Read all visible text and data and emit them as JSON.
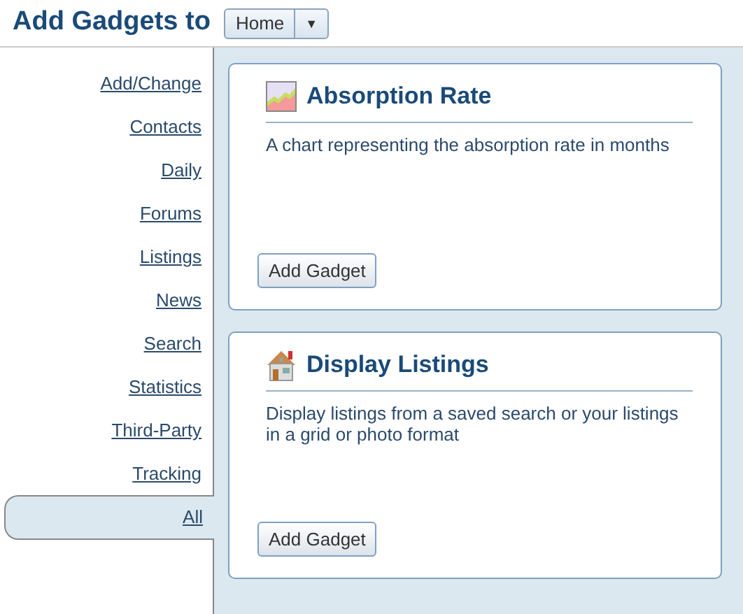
{
  "header": {
    "title": "Add Gadgets to",
    "dropdown": {
      "value": "Home",
      "caret": "▼"
    }
  },
  "sidebar": {
    "items": [
      {
        "label": "Add/Change",
        "selected": false
      },
      {
        "label": "Contacts",
        "selected": false
      },
      {
        "label": "Daily",
        "selected": false
      },
      {
        "label": "Forums",
        "selected": false
      },
      {
        "label": "Listings",
        "selected": false
      },
      {
        "label": "News",
        "selected": false
      },
      {
        "label": "Search",
        "selected": false
      },
      {
        "label": "Statistics",
        "selected": false
      },
      {
        "label": "Third-Party",
        "selected": false
      },
      {
        "label": "Tracking",
        "selected": false
      },
      {
        "label": "All",
        "selected": true
      }
    ]
  },
  "gadgets": [
    {
      "kind": "chart",
      "title": "Absorption Rate",
      "description": "A chart representing the absorption rate in months",
      "button": "Add Gadget"
    },
    {
      "kind": "house",
      "title": "Display Listings",
      "description": "Display listings from a saved search or your listings in a grid or photo format",
      "button": "Add Gadget"
    }
  ]
}
